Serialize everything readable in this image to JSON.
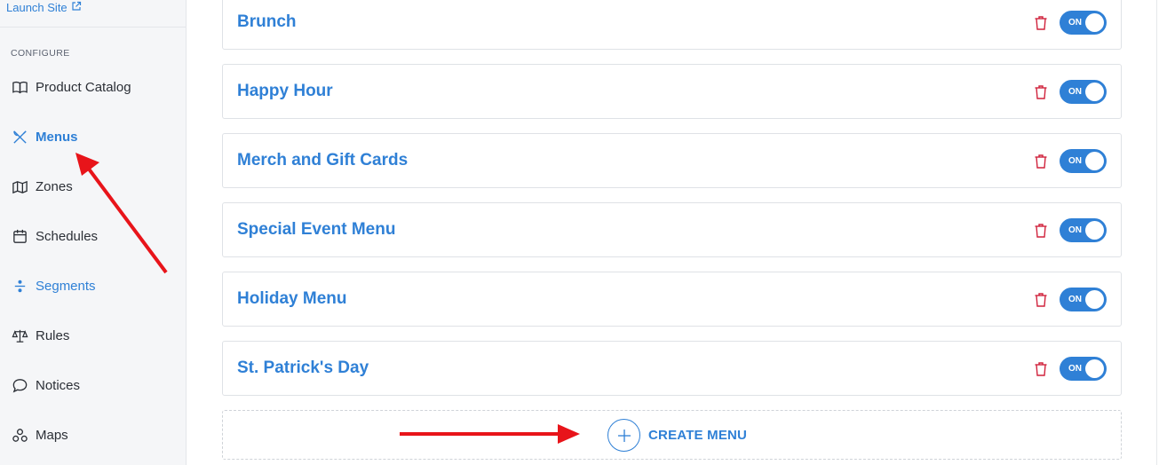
{
  "sidebar": {
    "launch_site": "Launch Site",
    "section_label": "CONFIGURE",
    "items": [
      {
        "label": "Product Catalog",
        "icon": "book-icon"
      },
      {
        "label": "Menus",
        "icon": "utensils-icon"
      },
      {
        "label": "Zones",
        "icon": "map-icon"
      },
      {
        "label": "Schedules",
        "icon": "calendar-icon"
      },
      {
        "label": "Segments",
        "icon": "divide-icon"
      },
      {
        "label": "Rules",
        "icon": "scales-icon"
      },
      {
        "label": "Notices",
        "icon": "speech-bubble-icon"
      },
      {
        "label": "Maps",
        "icon": "pins-icon"
      }
    ],
    "active_item": "Menus"
  },
  "menus": [
    {
      "name": "Brunch",
      "toggle": "ON"
    },
    {
      "name": "Happy Hour",
      "toggle": "ON"
    },
    {
      "name": "Merch and Gift Cards",
      "toggle": "ON"
    },
    {
      "name": "Special Event Menu",
      "toggle": "ON"
    },
    {
      "name": "Holiday Menu",
      "toggle": "ON"
    },
    {
      "name": "St. Patrick's Day",
      "toggle": "ON"
    }
  ],
  "create_menu_label": "CREATE MENU",
  "colors": {
    "accent": "#2f80d6",
    "trash": "#d0223c",
    "annotation_arrow": "#e8141a",
    "sidebar_bg": "#f5f6f8"
  }
}
